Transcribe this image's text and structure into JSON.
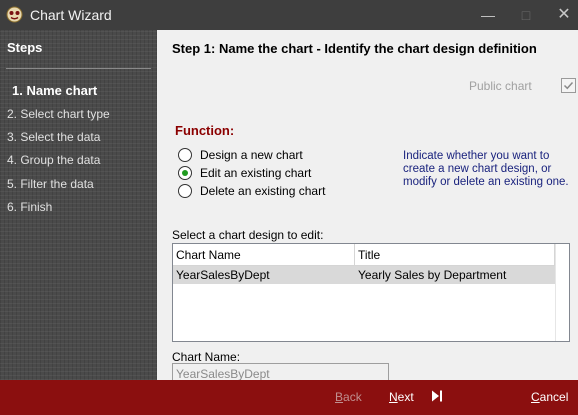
{
  "window": {
    "title": "Chart Wizard",
    "controls": {
      "minimize": "—",
      "maximize": "□",
      "close": "✕"
    }
  },
  "sidebar": {
    "title": "Steps",
    "steps": [
      {
        "label": "1. Name chart",
        "active": true
      },
      {
        "label": "2. Select chart type",
        "active": false
      },
      {
        "label": "3. Select the data",
        "active": false
      },
      {
        "label": "4. Group the data",
        "active": false
      },
      {
        "label": "5. Filter the data",
        "active": false
      },
      {
        "label": "6. Finish",
        "active": false
      }
    ]
  },
  "main": {
    "header": "Step 1: Name the chart - Identify the chart design definition",
    "public_chart": {
      "label": "Public chart",
      "checked": true
    },
    "function_label": "Function:",
    "options": [
      {
        "label": "Design a new chart",
        "checked": false
      },
      {
        "label": "Edit an existing chart",
        "checked": true
      },
      {
        "label": "Delete an existing chart",
        "checked": false
      }
    ],
    "hint": "Indicate whether you want to create a new chart design, or modify or delete an existing one.",
    "grid_label": "Select a chart design to edit:",
    "grid": {
      "columns": [
        "Chart Name",
        "Title"
      ],
      "rows": [
        [
          "YearSalesByDept",
          "Yearly Sales by Department"
        ]
      ]
    },
    "chart_name_label": "Chart Name:",
    "chart_name_value": "YearSalesByDept"
  },
  "footer": {
    "back": {
      "prefix": "",
      "hot": "B",
      "rest": "ack"
    },
    "next": {
      "prefix": "",
      "hot": "N",
      "rest": "ext"
    },
    "cancel": {
      "prefix": "",
      "hot": "C",
      "rest": "ancel"
    },
    "skip_icon": "skip-to-end-icon"
  },
  "colors": {
    "footer_bg": "#8b0f0f",
    "function_label": "#8b0000",
    "hint_text": "#1a237e",
    "radio_checked": "#1f9b1f"
  }
}
